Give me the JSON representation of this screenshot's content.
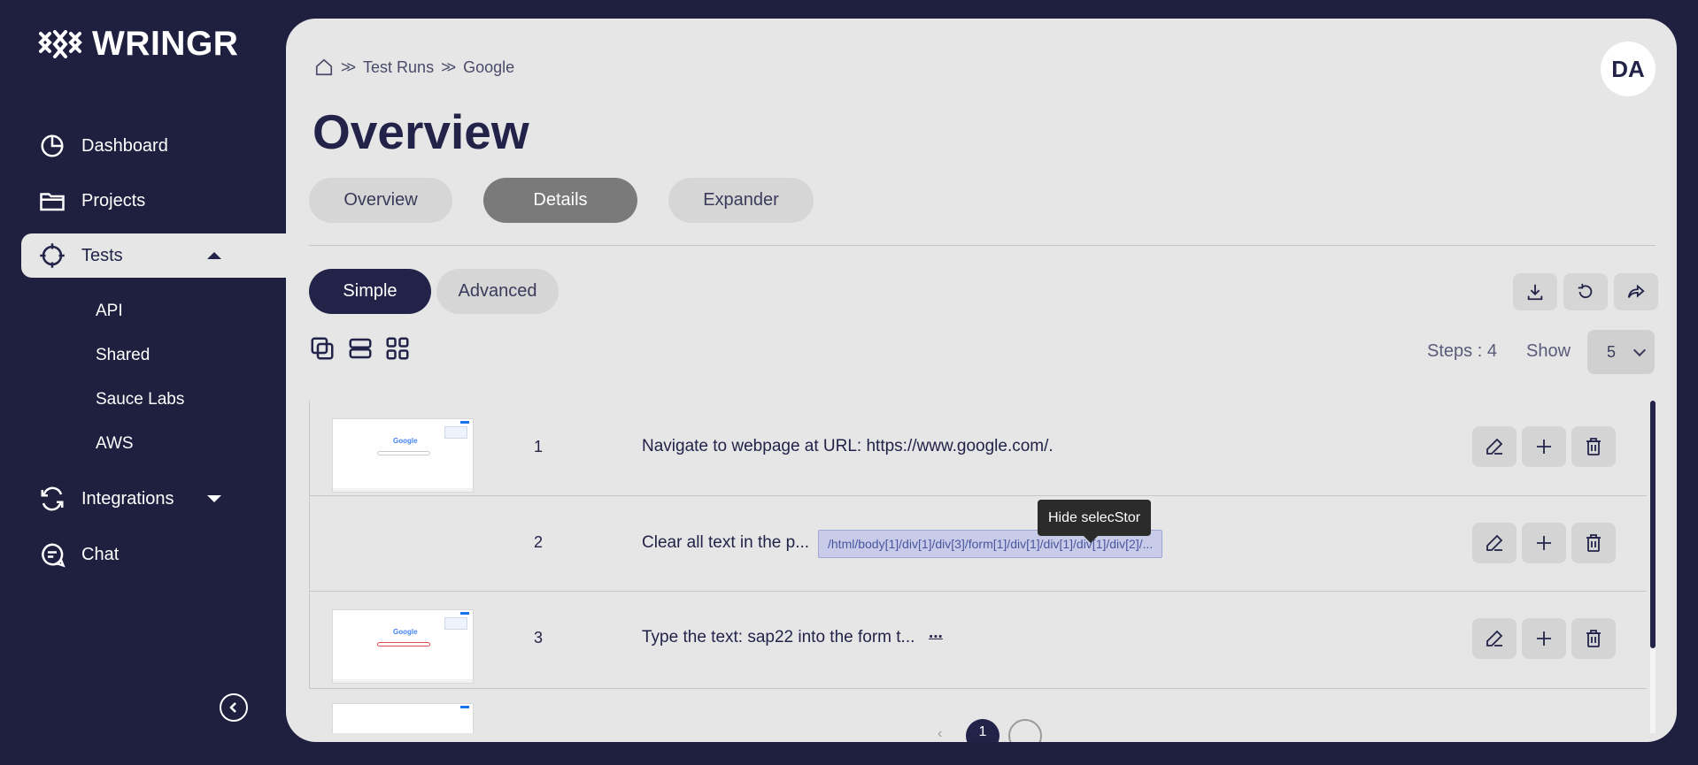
{
  "app": {
    "name": "WRINGR"
  },
  "sidebar": {
    "items": [
      {
        "label": "Dashboard",
        "icon": "pie-chart-icon"
      },
      {
        "label": "Projects",
        "icon": "folder-icon"
      },
      {
        "label": "Tests",
        "icon": "crosshair-icon",
        "active": true,
        "expanded": true
      },
      {
        "label": "Integrations",
        "icon": "refresh-icon",
        "expanded": false
      },
      {
        "label": "Chat",
        "icon": "chat-icon"
      }
    ],
    "subitems": [
      "API",
      "Shared",
      "Sauce Labs",
      "AWS"
    ],
    "collapse_icon": "chevron-left-icon"
  },
  "header": {
    "breadcrumb": [
      "Test Runs",
      "Google"
    ],
    "avatar": "DA",
    "title": "Overview"
  },
  "tabs": [
    "Overview",
    "Details",
    "Expander"
  ],
  "active_tab": "Details",
  "modes": [
    "Simple",
    "Advanced"
  ],
  "active_mode": "Simple",
  "toolbar": {
    "icons": [
      "download-icon",
      "refresh-icon",
      "share-icon"
    ]
  },
  "view_icons": [
    "copy-icon",
    "rows-icon",
    "grid-icon"
  ],
  "steps": {
    "label": "Steps : 4",
    "show_label": "Show",
    "show_value": "5"
  },
  "tooltip": "Hide selecStor",
  "rows": [
    {
      "num": "1",
      "text": "Navigate to webpage at URL: https://www.google.com/."
    },
    {
      "num": "2",
      "text": "Clear all text in the p...",
      "selector": "/html/body[1]/div[1]/div[3]/form[1]/div[1]/div[1]/div[1]/div[2]/..."
    },
    {
      "num": "3",
      "text": "Type the text: sap22 into the form t...",
      "more": "..."
    }
  ],
  "thumbnail": {
    "logo_text": "Google"
  },
  "pagination": {
    "current": "1"
  },
  "colors": {
    "sidebar_bg": "#1f1f3f",
    "panel_bg": "#e6e6e6",
    "primary": "#23234a",
    "selector_chip": "#c9cce8"
  }
}
